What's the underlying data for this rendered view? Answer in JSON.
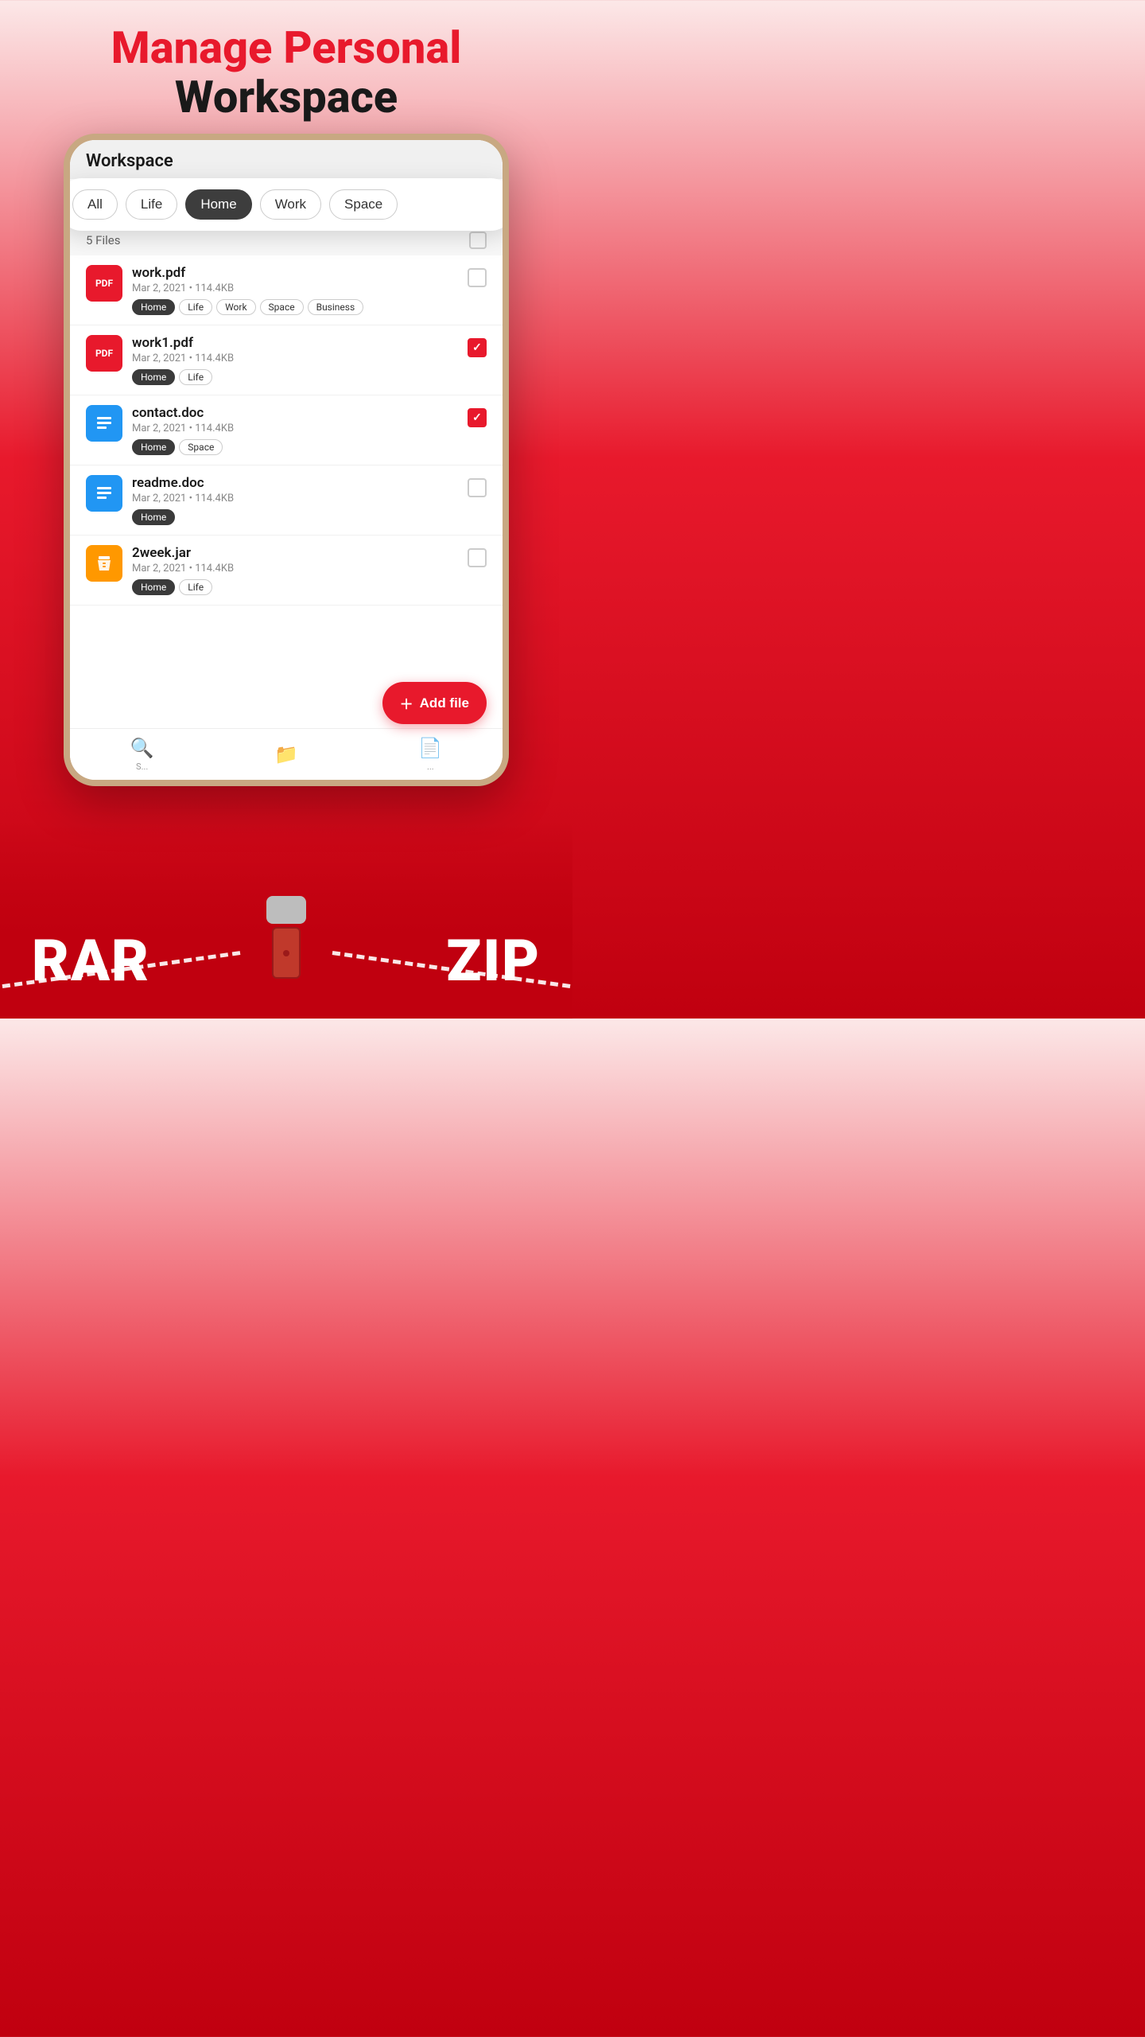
{
  "header": {
    "line1": "Manage Personal",
    "line2": "Workspace"
  },
  "phone": {
    "title": "Workspace",
    "filters": [
      {
        "label": "All",
        "active": false
      },
      {
        "label": "Life",
        "active": false
      },
      {
        "label": "Home",
        "active": true
      },
      {
        "label": "Work",
        "active": false
      },
      {
        "label": "Space",
        "active": false
      }
    ],
    "files_count": "5 Files",
    "files": [
      {
        "name": "work.pdf",
        "type": "pdf",
        "meta": "Mar 2, 2021 • 114.4KB",
        "tags": [
          {
            "label": "Home",
            "dark": true
          },
          {
            "label": "Life",
            "dark": false
          },
          {
            "label": "Work",
            "dark": false
          },
          {
            "label": "Space",
            "dark": false
          },
          {
            "label": "Business",
            "dark": false
          }
        ],
        "checked": false
      },
      {
        "name": "work1.pdf",
        "type": "pdf",
        "meta": "Mar 2, 2021 • 114.4KB",
        "tags": [
          {
            "label": "Home",
            "dark": true
          },
          {
            "label": "Life",
            "dark": false
          }
        ],
        "checked": true
      },
      {
        "name": "contact.doc",
        "type": "doc",
        "meta": "Mar 2, 2021 • 114.4KB",
        "tags": [
          {
            "label": "Home",
            "dark": true
          },
          {
            "label": "Space",
            "dark": false
          }
        ],
        "checked": true
      },
      {
        "name": "readme.doc",
        "type": "doc",
        "meta": "Mar 2, 2021 • 114.4KB",
        "tags": [
          {
            "label": "Home",
            "dark": true
          }
        ],
        "checked": false
      },
      {
        "name": "2week.jar",
        "type": "jar",
        "meta": "Mar 2, 2021 • 114.4KB",
        "tags": [
          {
            "label": "Home",
            "dark": true
          },
          {
            "label": "Life",
            "dark": false
          }
        ],
        "checked": false
      }
    ],
    "add_file_label": "Add file",
    "bottom_nav": [
      {
        "icon": "🔍",
        "label": "S..."
      },
      {
        "icon": "📁",
        "label": ""
      },
      {
        "icon": "📄",
        "label": "..."
      }
    ]
  },
  "footer": {
    "rar_label": "RAR",
    "zip_label": "ZIP"
  }
}
